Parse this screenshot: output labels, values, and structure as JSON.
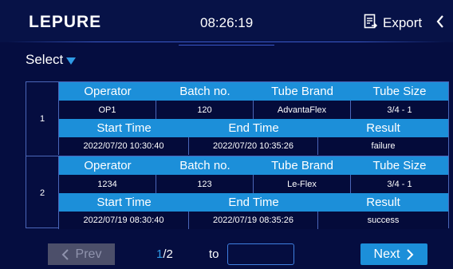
{
  "header": {
    "logo": "LEPURE",
    "time": "08:26:19",
    "export_label": "Export",
    "export_icon": "export-document-icon",
    "back_icon": "chevron-left-icon"
  },
  "filter": {
    "select_label": "Select"
  },
  "columns": {
    "row1": [
      "Operator",
      "Batch no.",
      "Tube Brand",
      "Tube Size"
    ],
    "row2": [
      "Start Time",
      "End Time",
      "Result"
    ]
  },
  "records": [
    {
      "index": "1",
      "operator": "OP1",
      "batch_no": "120",
      "tube_brand": "AdvantaFlex",
      "tube_size": "3/4 - 1",
      "start_time": "2022/07/20 10:30:40",
      "end_time": "2022/07/20 10:35:26",
      "result": "failure"
    },
    {
      "index": "2",
      "operator": "1234",
      "batch_no": "123",
      "tube_brand": "Le-Flex",
      "tube_size": "3/4 - 1",
      "start_time": "2022/07/19 08:30:40",
      "end_time": "2022/07/19 08:35:26",
      "result": "success"
    }
  ],
  "pager": {
    "prev_label": "Prev",
    "current_page": "1",
    "total_pages": "/2",
    "to_label": "to",
    "to_value": "",
    "next_label": "Next"
  },
  "colors": {
    "background": "#040b3a",
    "header_row": "#1c8fd9",
    "accent": "#2f9be6",
    "disabled_button": "#4c4f6a"
  }
}
